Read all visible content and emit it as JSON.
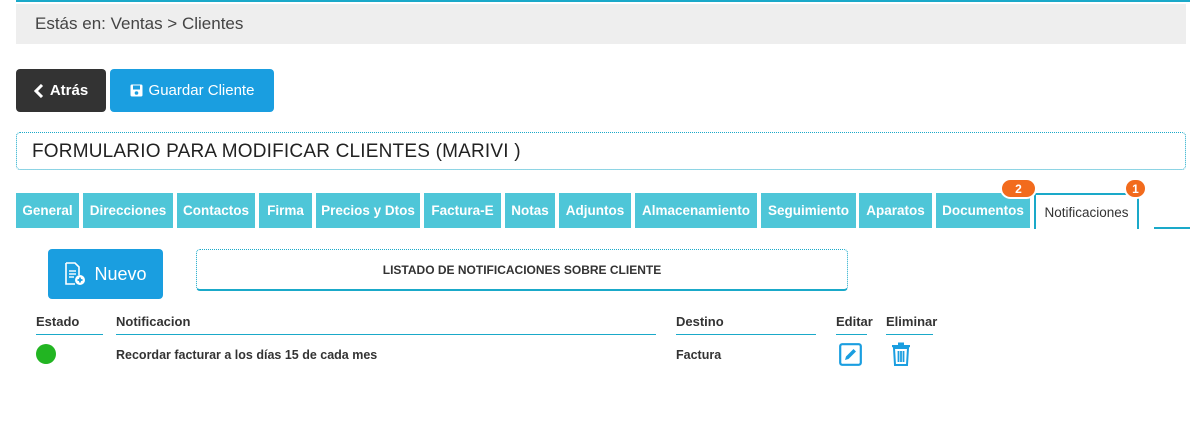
{
  "breadcrumb": {
    "text": "Estás en: Ventas > Clientes"
  },
  "actions": {
    "back_label": "Atrás",
    "save_label": "Guardar Cliente"
  },
  "form": {
    "title": "FORMULARIO PARA MODIFICAR CLIENTES (MARIVI )"
  },
  "tabs": [
    {
      "label": "General"
    },
    {
      "label": "Direcciones"
    },
    {
      "label": "Contactos"
    },
    {
      "label": "Firma"
    },
    {
      "label": "Precios y Dtos"
    },
    {
      "label": "Factura-E"
    },
    {
      "label": "Notas"
    },
    {
      "label": "Adjuntos"
    },
    {
      "label": "Almacenamiento"
    },
    {
      "label": "Seguimiento"
    },
    {
      "label": "Aparatos"
    },
    {
      "label": "Documentos",
      "badge": "2"
    },
    {
      "label": "Notificaciones",
      "badge": "1",
      "active": true
    }
  ],
  "notifications": {
    "new_label": "Nuevo",
    "list_title": "LISTADO DE NOTIFICACIONES SOBRE CLIENTE",
    "columns": {
      "estado": "Estado",
      "notificacion": "Notificacion",
      "destino": "Destino",
      "editar": "Editar",
      "eliminar": "Eliminar"
    },
    "rows": [
      {
        "status_color": "#22b522",
        "notificacion": "Recordar facturar a los días 15 de cada mes",
        "destino": "Factura",
        "edit_icon": "edit-icon",
        "delete_icon": "trash-icon"
      }
    ]
  },
  "colors": {
    "accent": "#1aa9c9",
    "primary_button": "#1a9ee0",
    "tab": "#4ec6d8",
    "badge": "#f26b1d",
    "dark_button": "#333333"
  }
}
